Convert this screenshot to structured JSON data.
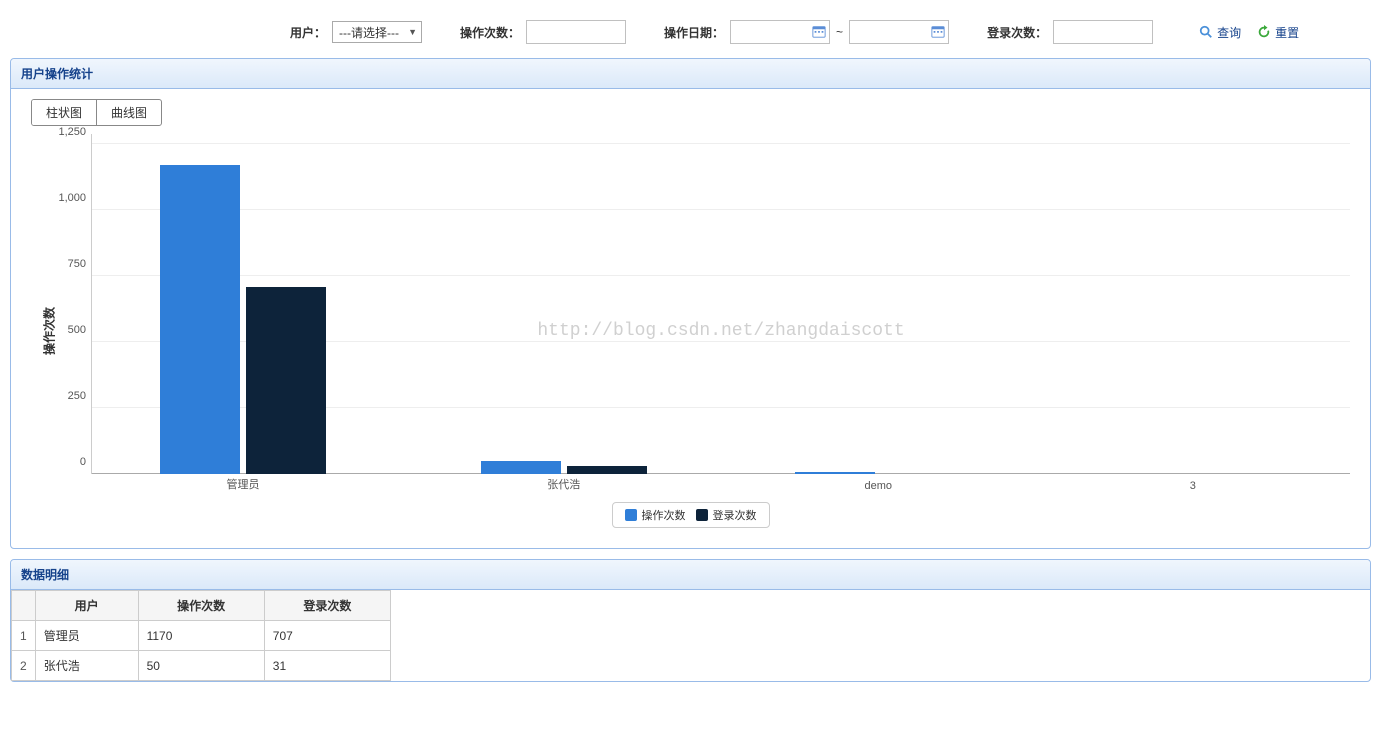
{
  "filter": {
    "user_label": "用户：",
    "user_placeholder": "---请选择---",
    "ops_label": "操作次数：",
    "date_label": "操作日期：",
    "date_sep": "~",
    "login_label": "登录次数：",
    "query_btn": "查询",
    "reset_btn": "重置"
  },
  "panel_chart": {
    "title": "用户操作统计",
    "tab_bar": "柱状图",
    "tab_line": "曲线图"
  },
  "chart_data": {
    "type": "bar",
    "ylabel": "操作次数",
    "ylim": [
      0,
      1250
    ],
    "yticks": [
      0,
      250,
      500,
      750,
      1000,
      1250
    ],
    "ytick_labels": [
      "0",
      "250",
      "500",
      "750",
      "1,000",
      "1,250"
    ],
    "categories": [
      "管理员",
      "张代浩",
      "demo",
      "3"
    ],
    "series": [
      {
        "name": "操作次数",
        "key": "ops",
        "values": [
          1170,
          50,
          7,
          0
        ]
      },
      {
        "name": "登录次数",
        "key": "login",
        "values": [
          707,
          31,
          0,
          0
        ]
      }
    ],
    "watermark": "http://blog.csdn.net/zhangdaiscott"
  },
  "panel_detail": {
    "title": "数据明细",
    "columns": [
      "用户",
      "操作次数",
      "登录次数"
    ],
    "rows": [
      {
        "idx": 1,
        "user": "管理员",
        "ops": 1170,
        "login": 707
      },
      {
        "idx": 2,
        "user": "张代浩",
        "ops": 50,
        "login": 31
      }
    ]
  }
}
